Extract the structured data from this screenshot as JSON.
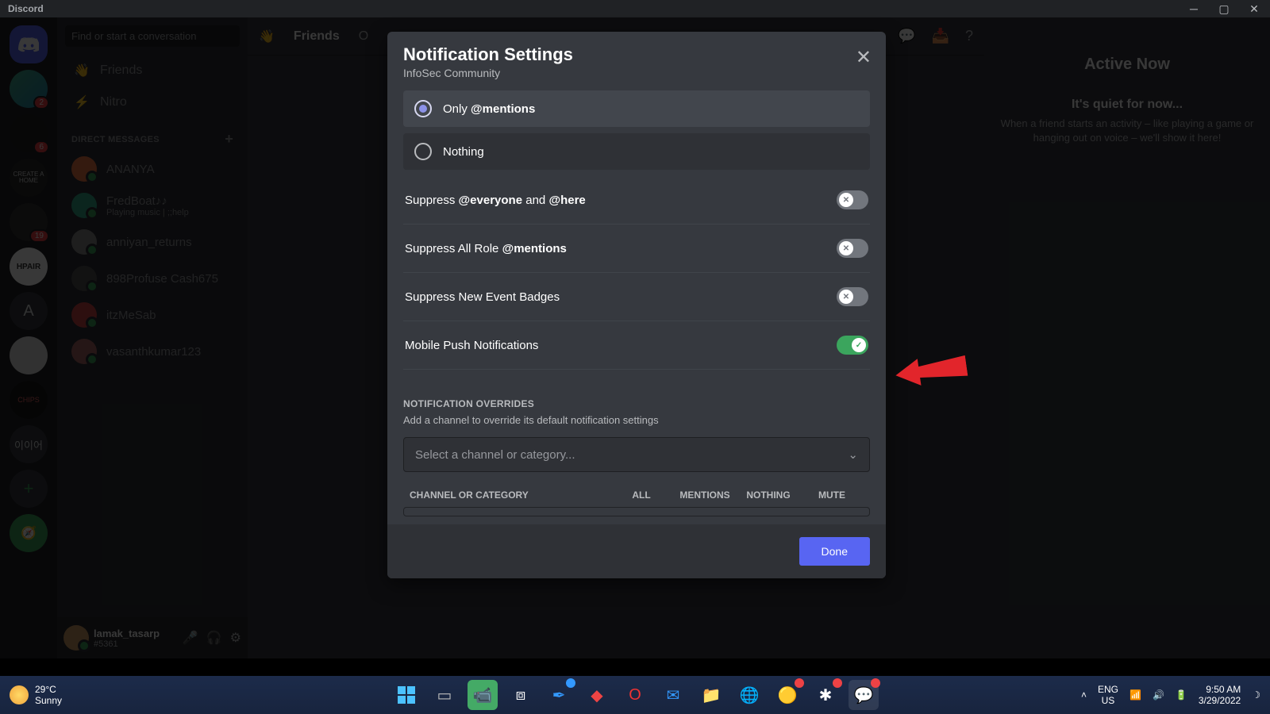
{
  "titlebar": {
    "app": "Discord"
  },
  "servers": [
    {
      "name": "home",
      "badge": ""
    },
    {
      "name": "srv1",
      "badge": "2"
    },
    {
      "name": "srv2",
      "badge": "6"
    },
    {
      "name": "srv3",
      "badge": ""
    },
    {
      "name": "srv4",
      "badge": "19"
    },
    {
      "name": "srv5",
      "badge": ""
    },
    {
      "name": "HPAIR",
      "badge": ""
    },
    {
      "name": "A",
      "badge": ""
    },
    {
      "name": "srv8",
      "badge": ""
    },
    {
      "name": "srv9",
      "badge": ""
    },
    {
      "name": "srv10",
      "badge": ""
    }
  ],
  "search_placeholder": "Find or start a conversation",
  "dm_items": {
    "friends": "Friends",
    "nitro": "Nitro"
  },
  "dm_header": "DIRECT MESSAGES",
  "dms": [
    {
      "name": "ANANYA",
      "sub": ""
    },
    {
      "name": "FredBoat♪♪",
      "sub": "Playing music | ;;help"
    },
    {
      "name": "anniyan_returns",
      "sub": ""
    },
    {
      "name": "898Profuse Cash675",
      "sub": ""
    },
    {
      "name": "itzMeSab",
      "sub": ""
    },
    {
      "name": "vasanthkumar123",
      "sub": ""
    }
  ],
  "user": {
    "name": "lamak_tasarp",
    "disc": "#5361"
  },
  "topnav": {
    "friends": "Friends",
    "online": "O"
  },
  "right": {
    "head": "Active Now",
    "sub1": "It's quiet for now...",
    "sub2": "When a friend starts an activity – like playing a game or hanging out on voice – we'll show it here!"
  },
  "modal": {
    "title": "Notification Settings",
    "subtitle": "InfoSec Community",
    "radio1_pre": "Only ",
    "radio1_b": "@mentions",
    "radio2": "Nothing",
    "t1_pre": "Suppress ",
    "t1_b1": "@everyone",
    "t1_mid": " and ",
    "t1_b2": "@here",
    "t2_pre": "Suppress All Role ",
    "t2_b": "@mentions",
    "t3": "Suppress New Event Badges",
    "t4": "Mobile Push Notifications",
    "overrides_head": "NOTIFICATION OVERRIDES",
    "overrides_desc": "Add a channel to override its default notification settings",
    "select_placeholder": "Select a channel or category...",
    "th_channel": "CHANNEL OR CATEGORY",
    "th_all": "ALL",
    "th_mentions": "MENTIONS",
    "th_nothing": "NOTHING",
    "th_mute": "MUTE",
    "done": "Done"
  },
  "taskbar": {
    "temp": "29°C",
    "cond": "Sunny",
    "lang1": "ENG",
    "lang2": "US",
    "time": "9:50 AM",
    "date": "3/29/2022"
  }
}
